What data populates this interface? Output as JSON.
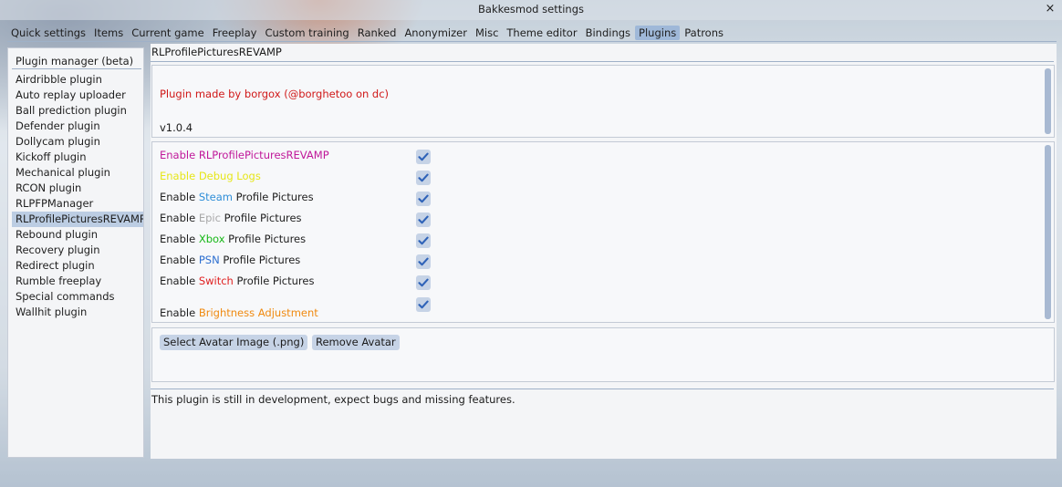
{
  "window": {
    "title": "Bakkesmod settings",
    "close_symbol": "×"
  },
  "tabs": [
    {
      "label": "Quick settings",
      "active": false
    },
    {
      "label": "Items",
      "active": false
    },
    {
      "label": "Current game",
      "active": false
    },
    {
      "label": "Freeplay",
      "active": false
    },
    {
      "label": "Custom training",
      "active": false
    },
    {
      "label": "Ranked",
      "active": false
    },
    {
      "label": "Anonymizer",
      "active": false
    },
    {
      "label": "Misc",
      "active": false
    },
    {
      "label": "Theme editor",
      "active": false
    },
    {
      "label": "Bindings",
      "active": false
    },
    {
      "label": "Plugins",
      "active": true
    },
    {
      "label": "Patrons",
      "active": false
    }
  ],
  "sidebar": {
    "title": "Plugin manager (beta)",
    "items": [
      "Airdribble plugin",
      "Auto replay uploader",
      "Ball prediction plugin",
      "Defender plugin",
      "Dollycam plugin",
      "Kickoff plugin",
      "Mechanical plugin",
      "RCON plugin",
      "RLPFPManager",
      "RLProfilePicturesREVAMP",
      "Rebound plugin",
      "Recovery plugin",
      "Redirect plugin",
      "Rumble freeplay",
      "Special commands",
      "Wallhit plugin"
    ],
    "selected_index": 9
  },
  "plugin": {
    "name": "RLProfilePicturesREVAMP",
    "author_text": "Plugin made by borgox (@borghetoo on dc)",
    "version": "v1.0.4"
  },
  "options": [
    {
      "prefix": "Enable ",
      "highlight": "RLProfilePicturesREVAMP",
      "suffix": "",
      "prefix_color": "#c0189a",
      "highlight_color": "#c0189a",
      "checked": true
    },
    {
      "prefix": "Enable ",
      "highlight": "Debug Logs",
      "suffix": "",
      "prefix_color": "#e6e619",
      "highlight_color": "#e6e619",
      "checked": true
    },
    {
      "prefix": "Enable ",
      "highlight": "Steam",
      "suffix": " Profile Pictures",
      "prefix_color": "#1e1e1e",
      "highlight_color": "#2f8ed8",
      "checked": true
    },
    {
      "prefix": "Enable ",
      "highlight": "Epic",
      "suffix": " Profile Pictures",
      "prefix_color": "#1e1e1e",
      "highlight_color": "#a8a8a8",
      "checked": true
    },
    {
      "prefix": "Enable ",
      "highlight": "Xbox",
      "suffix": " Profile Pictures",
      "prefix_color": "#1e1e1e",
      "highlight_color": "#18b818",
      "checked": true
    },
    {
      "prefix": "Enable ",
      "highlight": "PSN",
      "suffix": " Profile Pictures",
      "prefix_color": "#1e1e1e",
      "highlight_color": "#2d6fd0",
      "checked": true
    },
    {
      "prefix": "Enable ",
      "highlight": "Switch",
      "suffix": " Profile Pictures",
      "prefix_color": "#1e1e1e",
      "highlight_color": "#e02020",
      "checked": true
    },
    {
      "prefix": "Enable ",
      "highlight": "Brightness Adjustment",
      "suffix": "",
      "prefix_color": "#1e1e1e",
      "highlight_color": "#f08a10",
      "checked": true
    }
  ],
  "buttons": {
    "select_avatar": "Select Avatar Image (.png)",
    "remove_avatar": "Remove Avatar"
  },
  "footer_text": "This plugin is still in development, expect bugs and missing features.",
  "colors": {
    "accent": "#9fb8d8",
    "checkmark": "#2e62b8",
    "author_text": "#d01818"
  }
}
